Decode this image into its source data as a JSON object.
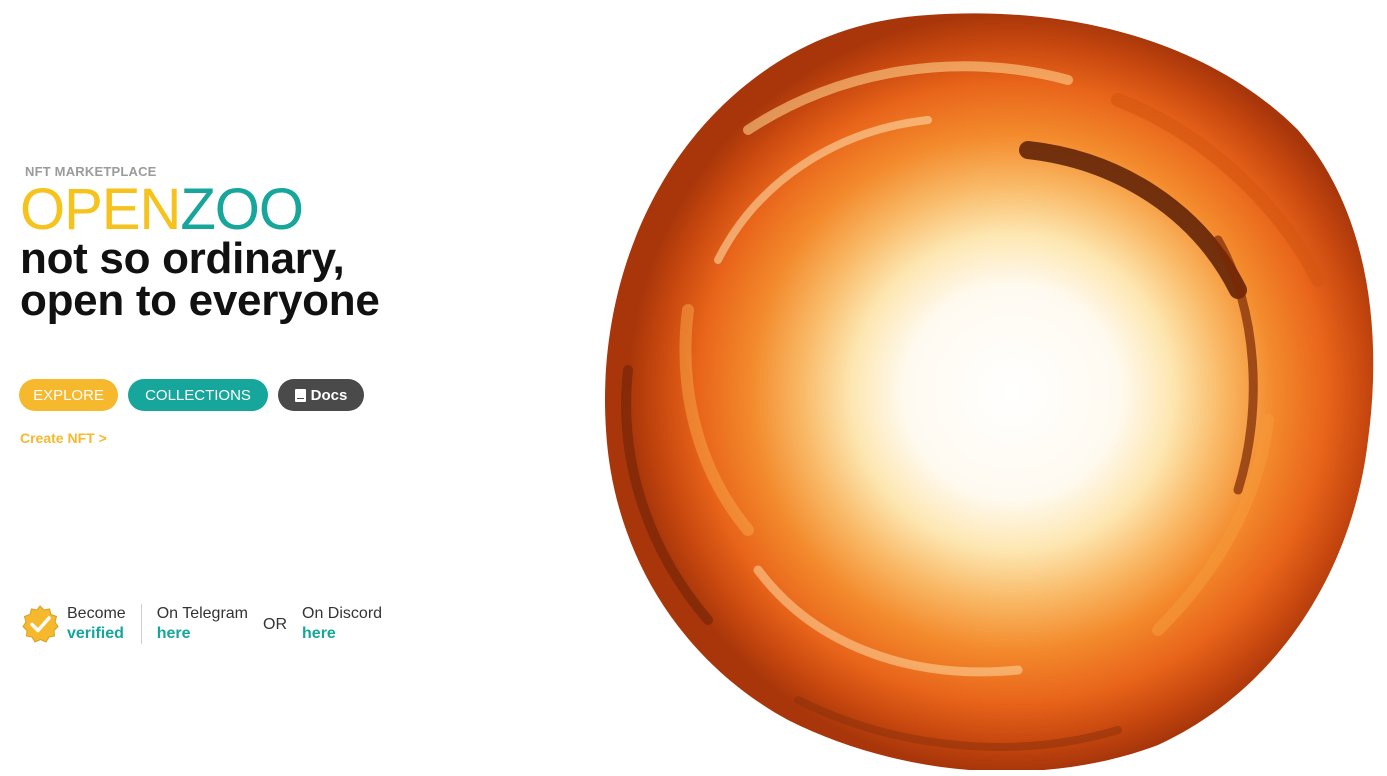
{
  "hero": {
    "eyebrow": "NFT MARKETPLACE",
    "brand_open": "OPEN",
    "brand_zoo": "ZOO",
    "tagline_line1": "not so ordinary,",
    "tagline_line2": "open to everyone"
  },
  "buttons": {
    "explore": "EXPLORE",
    "collections": "COLLECTIONS",
    "docs": "Docs"
  },
  "create_link": "Create NFT >",
  "verify": {
    "become": "Become",
    "verified": "verified",
    "telegram_label": "On Telegram",
    "telegram_link": "here",
    "or": "OR",
    "discord_label": "On Discord",
    "discord_link": "here"
  },
  "colors": {
    "brand_yellow": "#f6c21c",
    "brand_teal": "#16a69c",
    "docs_gray": "#4a4a4a"
  },
  "icons": {
    "docs": "book-icon",
    "verified": "verified-badge-icon"
  }
}
